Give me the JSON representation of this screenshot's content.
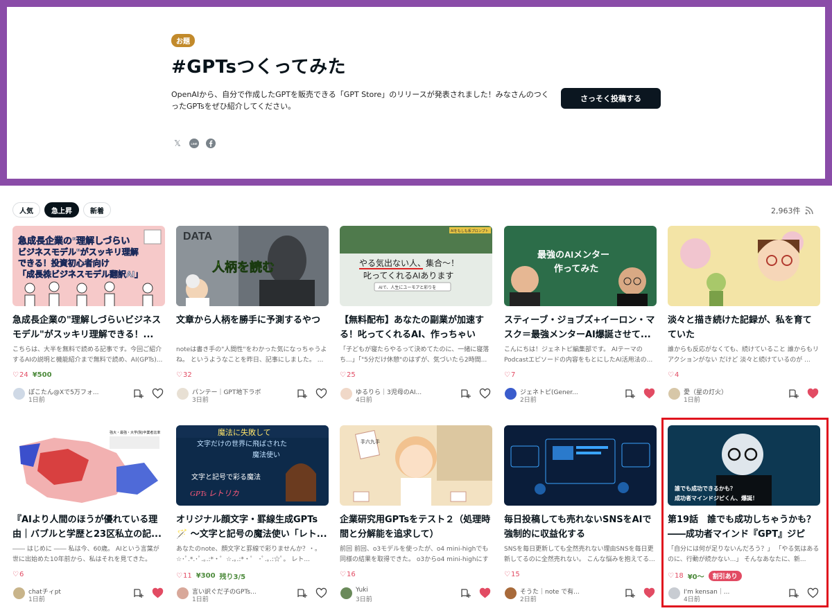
{
  "hero": {
    "badge": "お題",
    "title": "#GPTsつくってみた",
    "description": "OpenAIから、自分で作成したGPTを販売できる「GPT Store」のリリースが発表されました！みなさんのつくったGPTsをぜひ紹介してください。",
    "cta_label": "さっそく投稿する",
    "share": [
      "x-icon",
      "line-icon",
      "facebook-icon"
    ],
    "share_line_label": "LINE",
    "share_x_label": "𝕏"
  },
  "filters": {
    "items": [
      "人気",
      "急上昇",
      "新着"
    ],
    "active": "急上昇"
  },
  "count": "2,963件",
  "articles": [
    {
      "title": "急成長企業の\"理解しづらいビジネスモデル\"がスッキリ理解できる！...",
      "excerpt": "こちらは、大半を無料で読める記事です。今回ご紹介するAIの説明と機能紹介まで無料で読め、AI(GPTs)...",
      "likes": "24",
      "price": "¥500",
      "author": "ぽこたん@Xで5万フォ...",
      "date": "1日前",
      "liked": false,
      "thumb_text": [
        "急成長企業の\"理解しづらい",
        "ビジネスモデル\"がスッキリ理解",
        "できる！投資初心者向け",
        "「成長株ビジネスモデル翻訳AI」"
      ]
    },
    {
      "title": "文章から人柄を勝手に予測するやつ",
      "excerpt": "noteは書き手の\"人間性\"をわかった気になっちゃうよね。 というようなことを昨日、記事にしました。 ...",
      "likes": "32",
      "author": "パンテー｜GPT地下ラボ",
      "date": "3日前",
      "liked": false,
      "thumb_text": [
        "DATA",
        "人柄を読む"
      ]
    },
    {
      "title": "【無料配布】あなたの副業が加速する！叱ってくれるAI、作っちゃいま...",
      "excerpt": "「子どもが寝たらやるって決めてたのに、一緒に寝落ち...」「\"5分だけ休憩\"のはずが、気づいたら2時間...",
      "likes": "25",
      "author": "ゆるりら｜3児母のAI...",
      "date": "4日前",
      "liked": false,
      "thumb_text": [
        "AIをもしも系プロンプト",
        "やる気出ない人、集合〜！",
        "叱ってくれるAIあります",
        "AIで、人生にユーモアと彩りを"
      ]
    },
    {
      "title": "スティーブ・ジョブズ+イーロン・マスク＝最強メンターAI爆誕させて...",
      "excerpt": "こんにちは！ジェネトピ編集部です。 AIテーマのPodcastエピソードの内容をもとにしたAI活用法の...",
      "likes": "7",
      "author": "ジェネトピ(Gener...",
      "date": "2日前",
      "liked": true,
      "thumb_text": [
        "最強のAIメンター",
        "作ってみた"
      ]
    },
    {
      "title": "淡々と描き続けた記録が、私を育てていた",
      "excerpt": "誰からも反応がなくても、続けていること 誰からもリアクションがない だけど 淡々と続けているのが ...",
      "likes": "4",
      "author": "愛（星の灯火）",
      "date": "1日前",
      "liked": true,
      "thumb_text": []
    },
    {
      "title": "『AIより人間のほうが優れている理由｜バブルと学歴と23区私立の記...",
      "excerpt": "―― はじめに ―― 私は今、60歳。 AIという言葉が世に出始めた10年前から、私はそれを見てきた。 最...",
      "likes": "6",
      "author": "chatチィpt",
      "date": "1日前",
      "liked": true,
      "thumb_text": [
        "強大・最強・大学(院)卒業者比率"
      ]
    },
    {
      "title": "オリジナル顔文字・罫線生成GPTs🪄 〜文字と記号の魔法使い「レト...",
      "excerpt": "あなたのnote、顔文字と罫線で彩りませんか？・｡ ☆･ﾟ.*.･ﾟ.｡.:*・゜☆.｡.:*・゜ ･ﾟ.｡.:☆ﾟ。 レト...",
      "likes": "11",
      "price": "¥300",
      "remain": "残り3/5",
      "author": "言い訳ぐだ子のGPTs...",
      "date": "1日前",
      "liked": false,
      "thumb_text": [
        "魔法に失敗して",
        "文字だけの世界に飛ばされた",
        "魔法使い",
        "文字と記号で彩る魔法",
        "GPTs レトリカ"
      ]
    },
    {
      "title": "企業研究用GPTsをテスト２（処理時間と分解能を追求して）",
      "excerpt": "前回 前回、o3モデルを使ったが、o4 mini-highでも同様の結果を取得できた。 o3からo4 mini-highにする...",
      "likes": "16",
      "author": "Yuki",
      "date": "3日前",
      "liked": true,
      "thumb_text": [
        "手六九手"
      ]
    },
    {
      "title": "毎日投稿しても売れないSNSをAIで強制的に収益化する",
      "excerpt": "SNSを毎日更新しても全然売れない理由SNSを毎日更新してるのに全然売れない。 こんな悩みを抱えてる...",
      "likes": "15",
      "author": "そうた｜note で有...",
      "date": "2日前",
      "liked": true,
      "thumb_text": []
    },
    {
      "title": "第19話　誰でも成功しちゃうかも？――成功者マインド『GPT』ジピく...",
      "excerpt": "「自分には何が足りないんだろう？」 「やる気はあるのに、行動が続かない...」 そんなあなたに、新...",
      "likes": "18",
      "price": "¥0〜",
      "sale": "割引あり",
      "author": "I'm kensan｜...",
      "date": "4日前",
      "liked": false,
      "thumb_text": [
        "誰でも成功できるかも？",
        "成功者マインドジピくん、爆誕！"
      ]
    }
  ],
  "colors": {
    "hero_border": "#8a4ca8",
    "badge": "#c28a2b",
    "heart": "#e24b63",
    "price": "#4c8a3b",
    "highlight": "#e0141e"
  }
}
